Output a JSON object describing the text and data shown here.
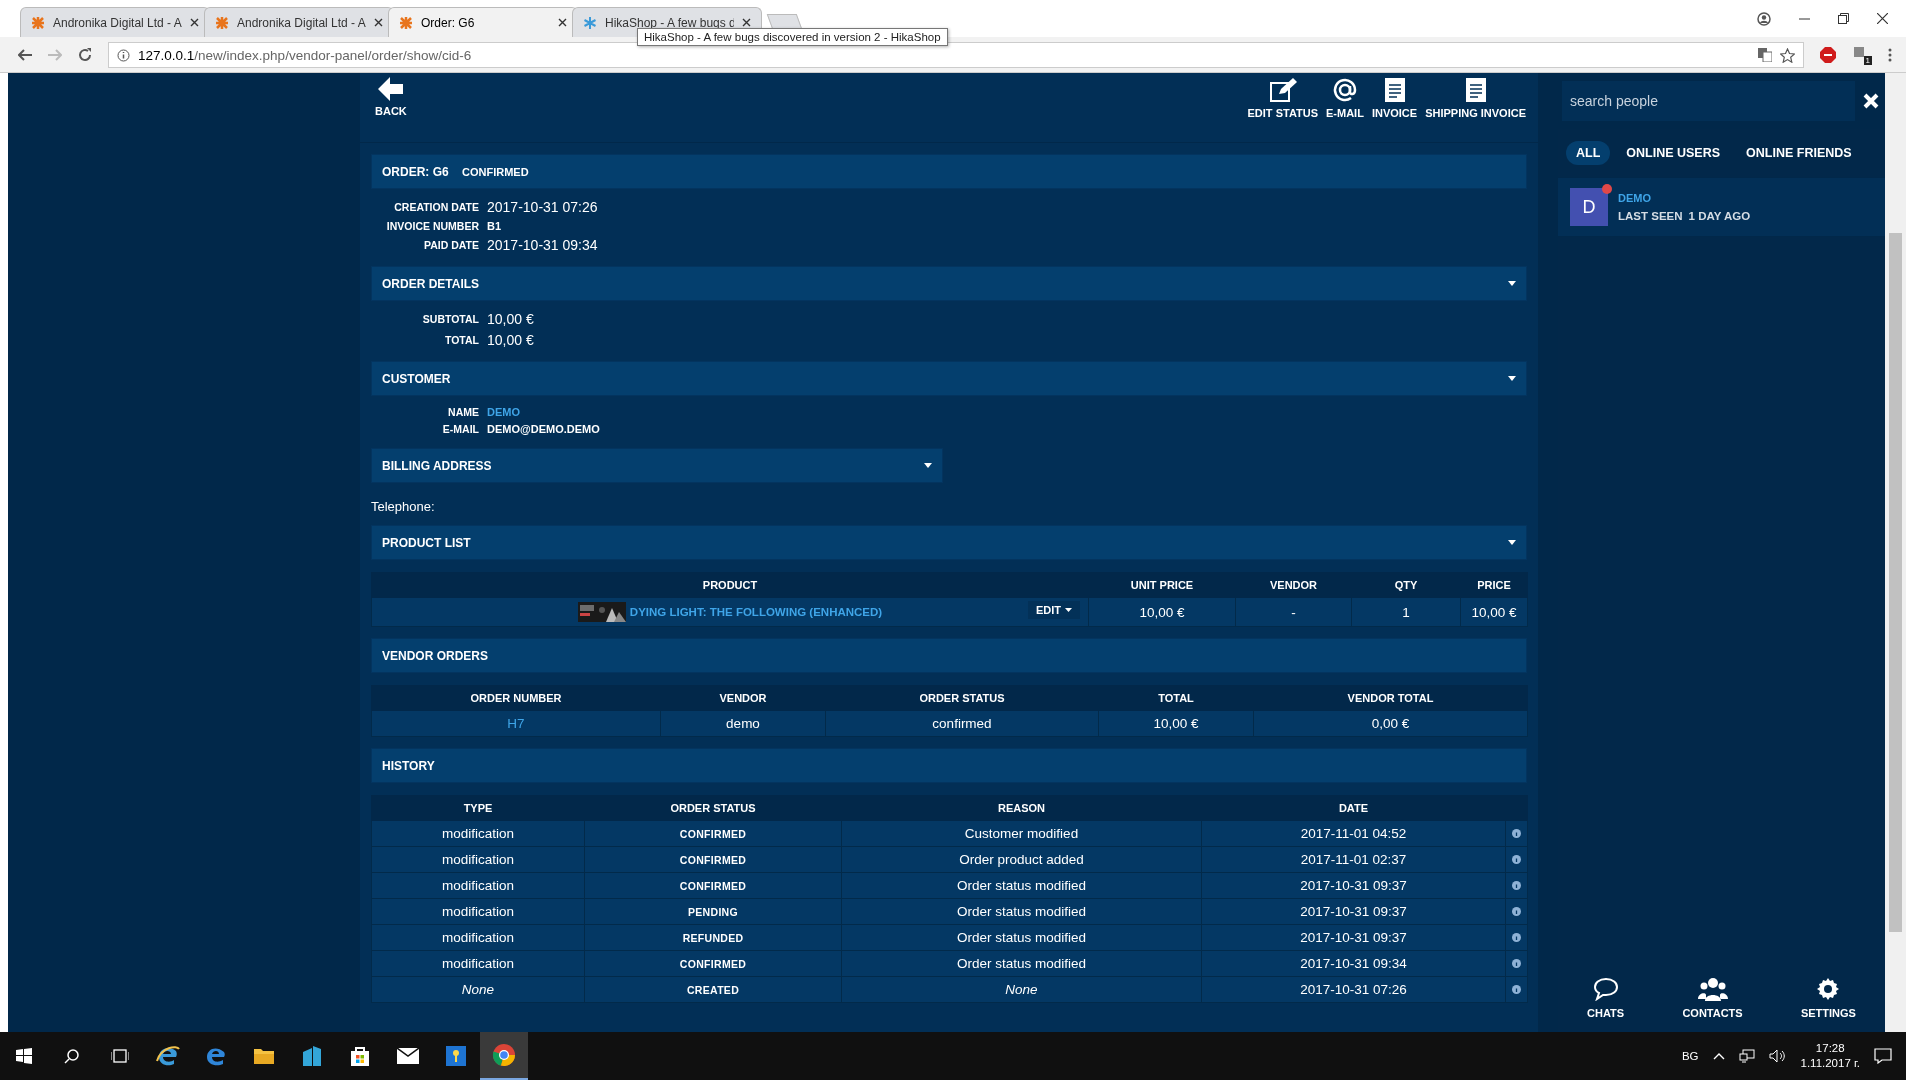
{
  "browser": {
    "tabs": [
      {
        "title": "Andronika Digital Ltd - A",
        "selected": false
      },
      {
        "title": "Andronika Digital Ltd - A",
        "selected": false
      },
      {
        "title": "Order: G6",
        "selected": true
      },
      {
        "title": "HikaShop - A few bugs d",
        "selected": false
      }
    ],
    "tooltip": "HikaShop - A few bugs discovered in version 2 - HikaShop",
    "url_host": "127.0.0.1",
    "url_path": "/new/index.php/vendor-panel/order/show/cid-6",
    "extension_badge": "1"
  },
  "toolbar": {
    "back": "BACK",
    "actions": [
      {
        "label": "EDIT STATUS",
        "kind": "edit"
      },
      {
        "label": "E-MAIL",
        "kind": "email"
      },
      {
        "label": "INVOICE",
        "kind": "invoice"
      },
      {
        "label": "SHIPPING INVOICE",
        "kind": "shipping"
      }
    ]
  },
  "order": {
    "title": "ORDER: G6",
    "status": "CONFIRMED",
    "fields": [
      {
        "label": "CREATION DATE",
        "value": "2017-10-31 07:26"
      },
      {
        "label": "INVOICE NUMBER",
        "value": "B1",
        "kind": "code"
      },
      {
        "label": "PAID DATE",
        "value": "2017-10-31 09:34"
      }
    ]
  },
  "order_details": {
    "title": "ORDER DETAILS",
    "fields": [
      {
        "label": "SUBTOTAL",
        "value": "10,00 €"
      },
      {
        "label": "TOTAL",
        "value": "10,00 €"
      }
    ]
  },
  "customer": {
    "title": "CUSTOMER",
    "fields": [
      {
        "label": "NAME",
        "value": "DEMO",
        "kind": "link"
      },
      {
        "label": "E-MAIL",
        "value": "DEMO@DEMO.DEMO",
        "kind": "code"
      }
    ]
  },
  "billing_address": {
    "title": "BILLING ADDRESS",
    "telephone_label": "Telephone:"
  },
  "product_list": {
    "title": "PRODUCT LIST",
    "columns": [
      "PRODUCT",
      "UNIT PRICE",
      "VENDOR",
      "QTY",
      "PRICE"
    ],
    "rows": [
      {
        "product": "DYING LIGHT: THE FOLLOWING (ENHANCED)",
        "edit": "EDIT",
        "unit_price": "10,00 €",
        "vendor": "-",
        "qty": "1",
        "price": "10,00 €"
      }
    ]
  },
  "vendor_orders": {
    "title": "VENDOR ORDERS",
    "columns": [
      "ORDER NUMBER",
      "VENDOR",
      "ORDER STATUS",
      "TOTAL",
      "VENDOR TOTAL"
    ],
    "rows": [
      {
        "order_number": "H7",
        "vendor": "demo",
        "order_status": "confirmed",
        "total": "10,00 €",
        "vendor_total": "0,00 €"
      }
    ]
  },
  "history": {
    "title": "HISTORY",
    "columns": [
      "TYPE",
      "ORDER STATUS",
      "REASON",
      "DATE"
    ],
    "rows": [
      {
        "kind": "modification",
        "type": "modification",
        "order_status": "CONFIRMED",
        "reason": "Customer modified",
        "date": "2017-11-01 04:52"
      },
      {
        "kind": "modification",
        "type": "modification",
        "order_status": "CONFIRMED",
        "reason": "Order product added",
        "date": "2017-11-01 02:37"
      },
      {
        "kind": "modification",
        "type": "modification",
        "order_status": "CONFIRMED",
        "reason": "Order status modified",
        "date": "2017-10-31 09:37"
      },
      {
        "kind": "modification",
        "type": "modification",
        "order_status": "PENDING",
        "reason": "Order status modified",
        "date": "2017-10-31 09:37"
      },
      {
        "kind": "modification",
        "type": "modification",
        "order_status": "REFUNDED",
        "reason": "Order status modified",
        "date": "2017-10-31 09:37"
      },
      {
        "kind": "modification",
        "type": "modification",
        "order_status": "CONFIRMED",
        "reason": "Order status modified",
        "date": "2017-10-31 09:34"
      },
      {
        "kind": "creation",
        "type": "None",
        "order_status": "CREATED",
        "reason": "None",
        "date": "2017-10-31 07:26"
      }
    ]
  },
  "sidebar": {
    "search": {
      "placeholder": "search people"
    },
    "filters": [
      {
        "label": "ALL",
        "selected": true
      },
      {
        "label": "ONLINE USERS",
        "selected": false
      },
      {
        "label": "ONLINE FRIENDS",
        "selected": false
      }
    ],
    "users": [
      {
        "initial": "D",
        "name": "DEMO",
        "last_seen_label": "LAST SEEN",
        "last_seen": "1 DAY AGO",
        "notification_dot": true
      }
    ],
    "nav": [
      {
        "label": "CHATS",
        "kind": "chats"
      },
      {
        "label": "CONTACTS",
        "kind": "contacts"
      },
      {
        "label": "SETTINGS",
        "kind": "settings"
      }
    ]
  },
  "taskbar": {
    "language": "BG",
    "time": "17:28",
    "date": "1.11.2017 г."
  }
}
